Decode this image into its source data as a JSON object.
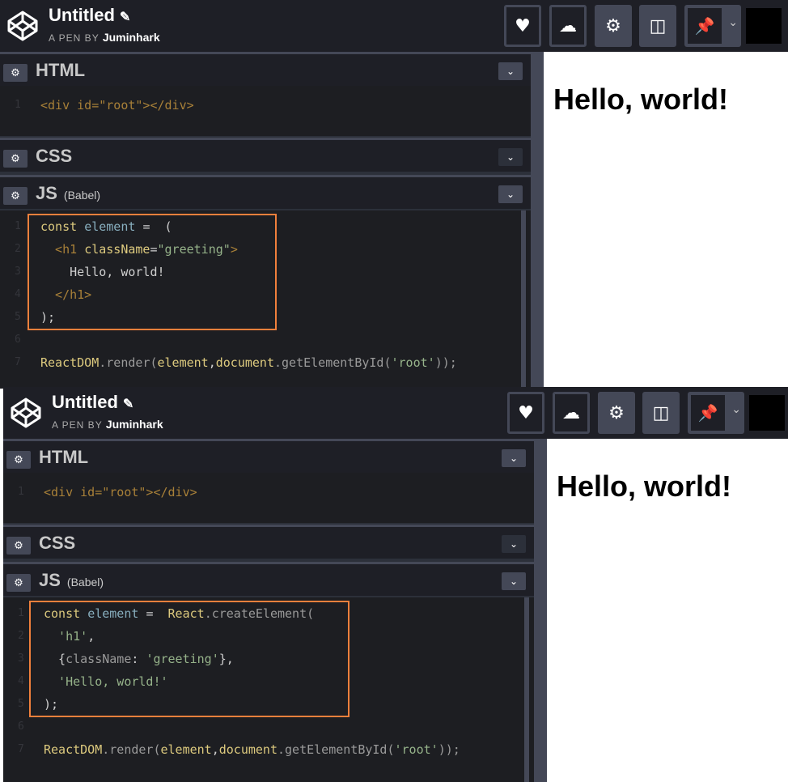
{
  "pen": {
    "title": "Untitled",
    "by_label": "A PEN BY",
    "author": "Juminhark"
  },
  "editors": {
    "html_label": "HTML",
    "css_label": "CSS",
    "js_label": "JS",
    "js_note": "(Babel)",
    "html_code": "<div id=\"root\"></div>"
  },
  "preview_text": "Hello, world!",
  "top_js": [
    "const element =  (",
    "  <h1 className=\"greeting\">",
    "    Hello, world!",
    "  </h1>",
    ");",
    "",
    "ReactDOM.render(element,document.getElementById('root'));"
  ],
  "bottom_js": [
    "const element =  React.createElement(",
    "  'h1',",
    "  {className: 'greeting'},",
    "  'Hello, world!'",
    ");",
    "",
    "ReactDOM.render(element,document.getElementById('root'));"
  ],
  "line_numbers": [
    "1",
    "2",
    "3",
    "4",
    "5",
    "6",
    "7"
  ],
  "icons": [
    "codepen-logo-icon",
    "pencil-icon",
    "heart-icon",
    "cloud-icon",
    "gear-icon",
    "preview-icon",
    "pin-icon",
    "chevron-down-icon",
    "avatar"
  ],
  "colors": {
    "topbar": "#1e1f26",
    "button": "#444857",
    "highlight": "#f0803c",
    "code_bg": "#1d1e22"
  }
}
